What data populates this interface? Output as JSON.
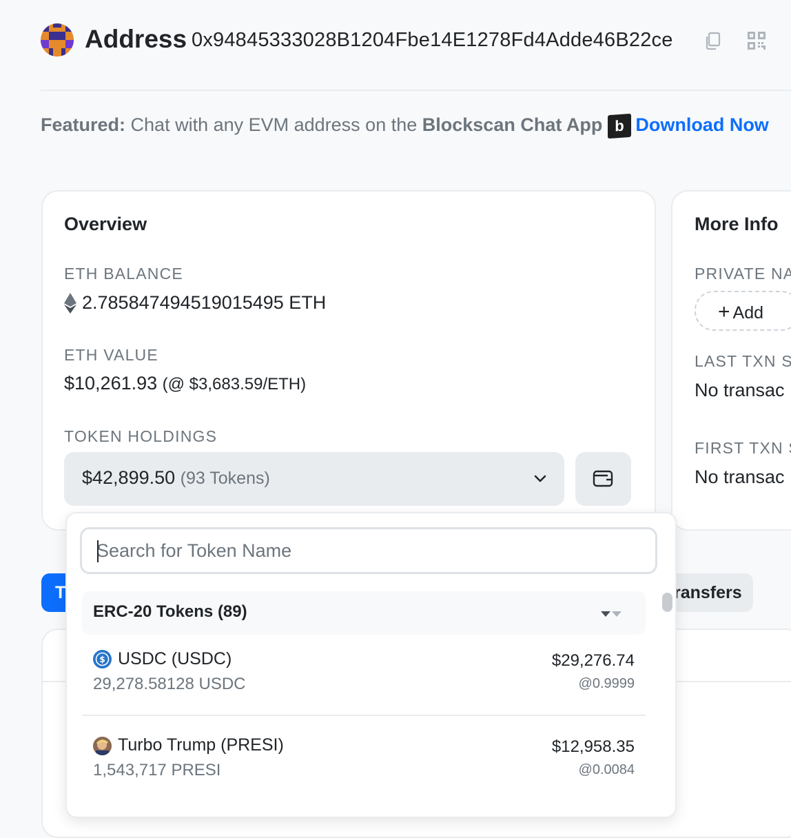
{
  "header": {
    "title": "Address",
    "address": "0x94845333028B1204Fbe14E1278Fd4Adde46B22ce"
  },
  "featured": {
    "prefix": "Featured:",
    "text": " Chat with any EVM address on the ",
    "app_name": "Blockscan Chat App",
    "logo_letter": "b",
    "link": "Download Now"
  },
  "overview": {
    "title": "Overview",
    "eth_balance_label": "ETH BALANCE",
    "eth_balance": "2.785847494519015495 ETH",
    "eth_value_label": "ETH VALUE",
    "eth_value": "$10,261.93",
    "eth_price": "(@ $3,683.59/ETH)",
    "token_holdings_label": "TOKEN HOLDINGS",
    "token_holdings_value": "$42,899.50",
    "token_count": "(93 Tokens)"
  },
  "more_info": {
    "title": "More Info",
    "private_label": "PRIVATE NA",
    "add_label": "Add",
    "last_txn_label": "LAST TXN S",
    "last_txn_value": "No transac",
    "first_txn_label": "FIRST TXN S",
    "first_txn_value": "No transac"
  },
  "tabs": {
    "active_partial": "T",
    "transfers_partial": "ransfers"
  },
  "dropdown": {
    "search_placeholder": "Search for Token Name",
    "group_title": "ERC-20 Tokens (89)",
    "tokens": [
      {
        "name": "USDC (USDC)",
        "balance": "29,278.58128 USDC",
        "usd": "$29,276.74",
        "rate": "@0.9999",
        "icon": "usdc-icon"
      },
      {
        "name": "Turbo Trump (PRESI)",
        "balance": "1,543,717 PRESI",
        "usd": "$12,958.35",
        "rate": "@0.0084",
        "icon": "presi-icon"
      }
    ]
  },
  "colors": {
    "accent": "#0d6efd",
    "background": "#f8f9fa",
    "muted": "#6c757d"
  }
}
